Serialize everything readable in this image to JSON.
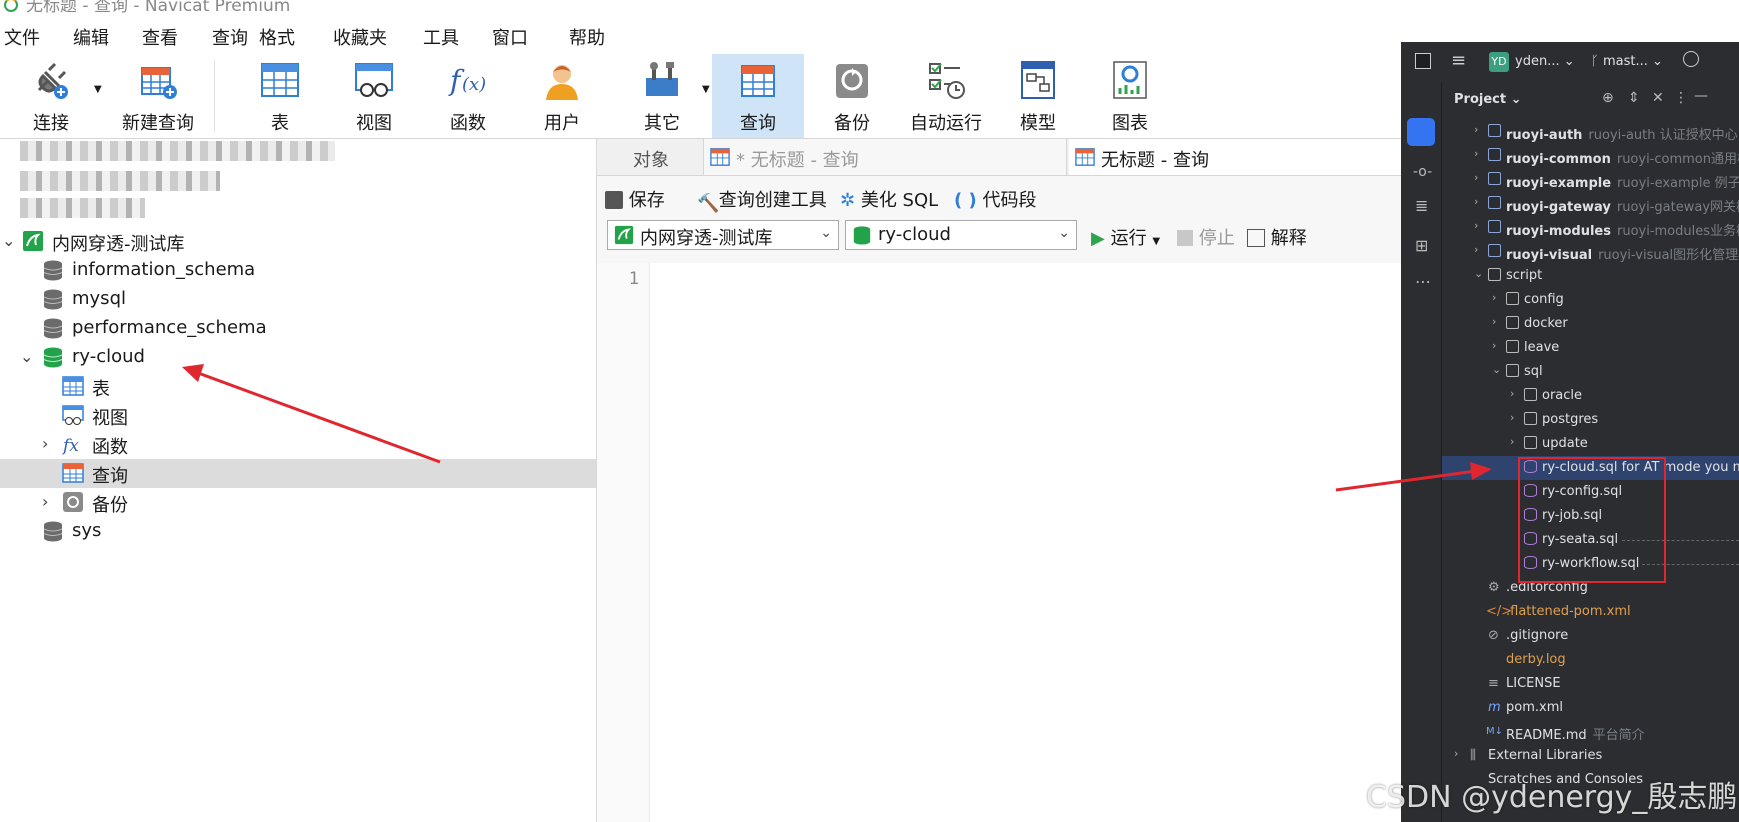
{
  "app": {
    "title": "无标题 - 查询 - Navicat Premium"
  },
  "menu": [
    "文件",
    "编辑",
    "查看",
    "查询",
    "格式",
    "收藏夹",
    "工具",
    "窗口",
    "帮助"
  ],
  "toolbar": {
    "connect": "连接",
    "new_query": "新建查询",
    "table": "表",
    "view": "视图",
    "function": "函数",
    "user": "用户",
    "other": "其它",
    "query": "查询",
    "backup": "备份",
    "automation": "自动运行",
    "model": "模型",
    "chart": "图表"
  },
  "tree": {
    "connection": "内网穿透-测试库",
    "databases": [
      "information_schema",
      "mysql",
      "performance_schema",
      "ry-cloud",
      "sys"
    ],
    "children": [
      "表",
      "视图",
      "函数",
      "查询",
      "备份"
    ]
  },
  "tabs": {
    "objects": "对象",
    "untitled_dirty": "* 无标题 - 查询",
    "untitled": "无标题 - 查询"
  },
  "editor_toolbar": {
    "save": "保存",
    "query_builder": "查询创建工具",
    "beautify": "美化 SQL",
    "snippet": "代码段",
    "connection_select": "内网穿透-测试库",
    "database_select": "ry-cloud",
    "run": "运行",
    "stop": "停止",
    "explain": "解释"
  },
  "editor": {
    "line1": "1"
  },
  "ide": {
    "project_badge": "YD",
    "project_name": "yden...",
    "branch": "mast...",
    "panel_title": "Project",
    "modules": [
      {
        "name": "ruoyi-auth",
        "desc": "ruoyi-auth 认证授权中心"
      },
      {
        "name": "ruoyi-common",
        "desc": "ruoyi-common通用模块"
      },
      {
        "name": "ruoyi-example",
        "desc": "ruoyi-example 例子模块"
      },
      {
        "name": "ruoyi-gateway",
        "desc": "ruoyi-gateway网关模块"
      },
      {
        "name": "ruoyi-modules",
        "desc": "ruoyi-modules业务模块"
      },
      {
        "name": "ruoyi-visual",
        "desc": "ruoyi-visual图形化管理模块"
      }
    ],
    "script": "script",
    "script_children": [
      "config",
      "docker",
      "leave",
      "sql"
    ],
    "sql_children": [
      "oracle",
      "postgres",
      "update"
    ],
    "sql_files": [
      "ry-cloud.sql for AT mode you m",
      "ry-config.sql",
      "ry-job.sql",
      "ry-seata.sql",
      "ry-workflow.sql"
    ],
    "root_files": [
      ".editorconfig",
      ".flattened-pom.xml",
      ".gitignore",
      "derby.log",
      "LICENSE",
      "pom.xml",
      "README.md"
    ],
    "readme_desc": "平台简介",
    "external_libraries": "External Libraries",
    "scratches": "Scratches and Consoles"
  },
  "watermark": "CSDN @ydenergy_殷志鹏",
  "colors": {
    "arrow": "#e0262e",
    "selection": "#cfe4f7",
    "ide_bg": "#2b2d30",
    "db_green": "#22a34a"
  }
}
